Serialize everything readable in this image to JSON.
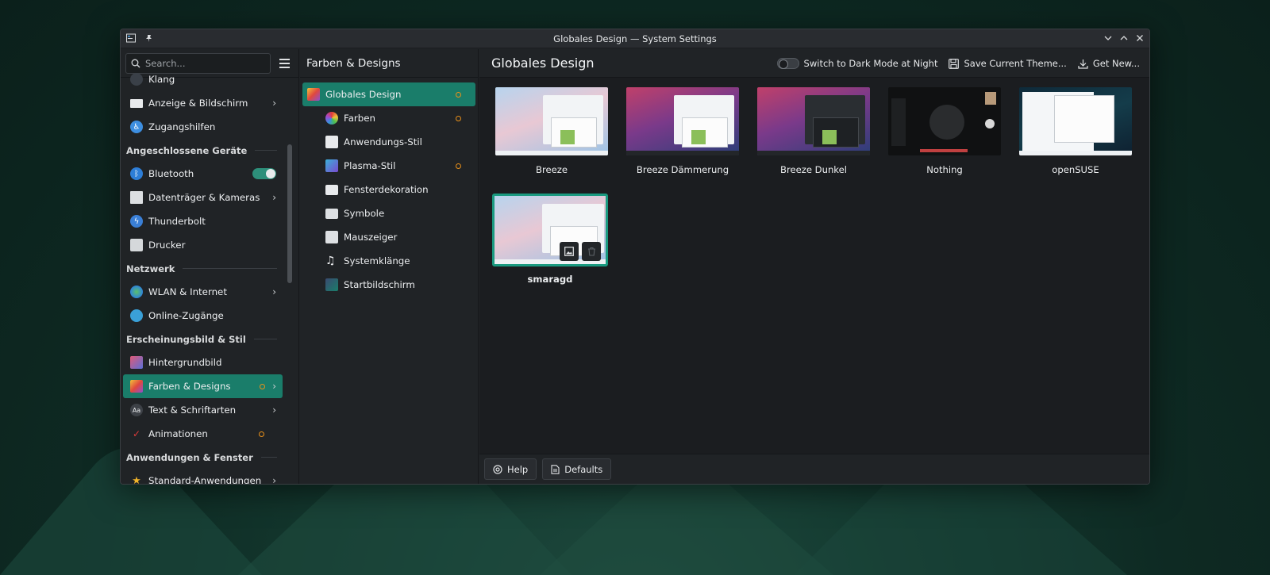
{
  "window": {
    "title": "Globales Design — System Settings"
  },
  "sidebar": {
    "search_placeholder": "Search...",
    "items": [
      {
        "label": "Klang"
      },
      {
        "label": "Anzeige & Bildschirm"
      },
      {
        "label": "Zugangshilfen"
      },
      {
        "section": "Angeschlossene Geräte"
      },
      {
        "label": "Bluetooth"
      },
      {
        "label": "Datenträger & Kameras"
      },
      {
        "label": "Thunderbolt"
      },
      {
        "label": "Drucker"
      },
      {
        "section": "Netzwerk"
      },
      {
        "label": "WLAN & Internet"
      },
      {
        "label": "Online-Zugänge"
      },
      {
        "section": "Erscheinungsbild & Stil"
      },
      {
        "label": "Hintergrundbild"
      },
      {
        "label": "Farben & Designs"
      },
      {
        "label": "Text & Schriftarten"
      },
      {
        "label": "Animationen"
      },
      {
        "section": "Anwendungen & Fenster"
      },
      {
        "label": "Standard-Anwendungen"
      }
    ]
  },
  "subpanel": {
    "title": "Farben & Designs",
    "items": [
      {
        "label": "Globales Design"
      },
      {
        "label": "Farben"
      },
      {
        "label": "Anwendungs-Stil"
      },
      {
        "label": "Plasma-Stil"
      },
      {
        "label": "Fensterdekoration"
      },
      {
        "label": "Symbole"
      },
      {
        "label": "Mauszeiger"
      },
      {
        "label": "Systemklänge"
      },
      {
        "label": "Startbildschirm"
      }
    ]
  },
  "main": {
    "title": "Globales Design",
    "actions": {
      "dark_mode": "Switch to Dark Mode at Night",
      "save_theme": "Save Current Theme...",
      "get_new": "Get New..."
    },
    "themes": [
      {
        "name": "Breeze"
      },
      {
        "name": "Breeze Dämmerung"
      },
      {
        "name": "Breeze Dunkel"
      },
      {
        "name": "Nothing"
      },
      {
        "name": "openSUSE"
      },
      {
        "name": "smaragd"
      }
    ],
    "footer": {
      "help": "Help",
      "defaults": "Defaults"
    }
  },
  "colors": {
    "accent": "#1a7d6a",
    "modified_dot": "#e8901a",
    "window_bg": "#202326"
  }
}
